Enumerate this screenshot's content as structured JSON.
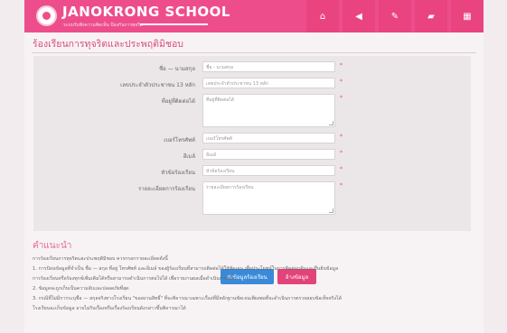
{
  "header": {
    "brand_name": "JANOKRONG SCHOOL",
    "brand_sub": "ระบบรับฟังความคิดเห็น ป้องกันการทุจริต",
    "nav_icons": [
      "home-icon",
      "megaphone-icon",
      "edit-icon",
      "chat-icon",
      "grid-icon"
    ],
    "nav_glyphs": [
      "⌂",
      "◀",
      "✎",
      "▰",
      "▦"
    ],
    "accent_color": "#ee4d8b"
  },
  "page_title": "ร้องเรียนการทุจริตและประพฤติมิชอบ",
  "form": {
    "fields": [
      {
        "label": "ชื่อ — นามสกุล",
        "placeholder": "ชื่อ - นามสกุล",
        "type": "text"
      },
      {
        "label": "เลขประจำตัวประชาชน 13 หลัก",
        "placeholder": "เลขประจำตัวประชาชน 13 หลัก",
        "type": "text"
      },
      {
        "label": "ที่อยู่ที่ติดต่อได้",
        "placeholder": "ที่อยู่ที่ติดต่อได้",
        "type": "textarea"
      },
      {
        "label": "เบอร์โทรศัพท์",
        "placeholder": "เบอร์โทรศัพท์",
        "type": "text"
      },
      {
        "label": "อีเมล์",
        "placeholder": "อีเมล์",
        "type": "text"
      },
      {
        "label": "หัวข้อร้องเรียน",
        "placeholder": "หัวข้อร้องเรียน",
        "type": "text"
      },
      {
        "label": "รายละเอียดการร้องเรียน",
        "placeholder": "รายละเอียดการร้องเรียน",
        "type": "textarea"
      }
    ],
    "required_mark": "*",
    "submit_label": "ส่งข้อมูลร้องเรียน",
    "reset_label": "ล้างข้อมูล"
  },
  "instructions": {
    "title": "คำแนะนำ",
    "lines": [
      "การร้องเรียนการทุจริตและประพฤติมิชอบ ควรกรอกรายละเอียดดังนี้",
      "1. การป้อนข้อมูลที่จำเป็น ชื่อ — สกุล ที่อยู่ โทรศัพท์ และอีเมล์ ของผู้ร้องเรียนที่สามารถติดต่อได้ให้ชัดเจน เพื่อประโยชน์ในการติดต่อกลับและยืนยันข้อมูล",
      "การร้องเรียนหรือร้องทุกข์เพิ่มเติมได้หรือสามารถดำเนินการต่อไปได้ เพื่อรายงานผลเมื่อดำเนินการแล้ว",
      "2. ข้อมูลจะถูกเก็บเป็นความลับและปลอดภัยที่สุด",
      "3. กรณีที่ไม่มีการระบุชื่อ — สกุลจริงทางโรงเรียน \"ขอสงวนสิทธิ์\" ที่จะพิจารณาเฉพาะเรื่องที่มีหลักฐานชัดเจนเพียงพอที่จะดำเนินการตรวจสอบข้อเท็จจริงได้",
      "โรงเรียนจะเก็บข้อมูล อาจไม่รับเรื่องหรือเรื่องร้องเรียนดังกล่าวขึ้นพิจารณาได้"
    ]
  }
}
